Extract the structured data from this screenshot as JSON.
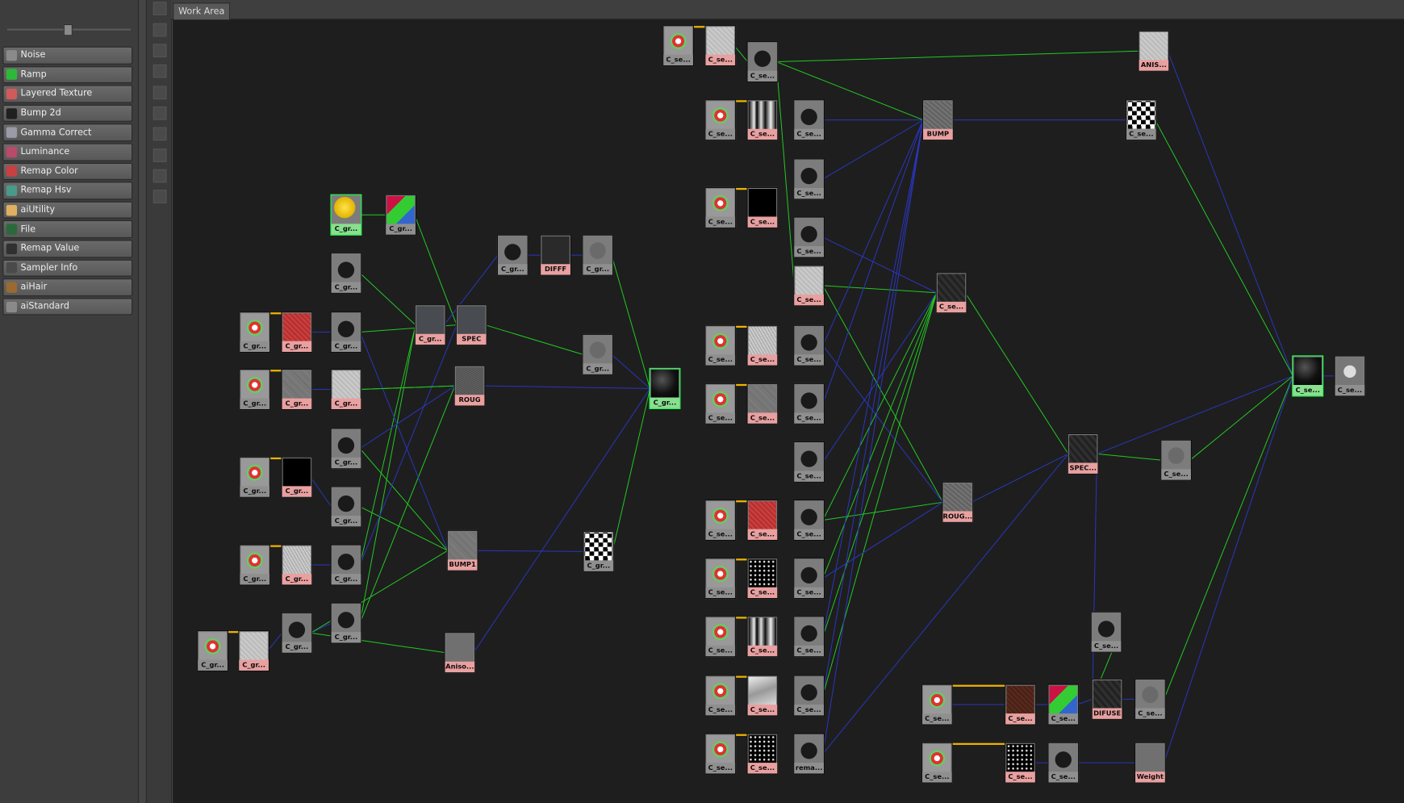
{
  "tab": {
    "label": "Work Area"
  },
  "library": {
    "items": [
      {
        "label": "Noise",
        "icon": "noise-icon",
        "color": "#8a8a8a"
      },
      {
        "label": "Ramp",
        "icon": "ramp-icon",
        "color": "#2eb83a"
      },
      {
        "label": "Layered Texture",
        "icon": "layered-texture-icon",
        "color": "#d05a5a"
      },
      {
        "label": "Bump 2d",
        "icon": "bump2d-icon",
        "color": "#202020"
      },
      {
        "label": "Gamma Correct",
        "icon": "gamma-correct-icon",
        "color": "#9a9aa8"
      },
      {
        "label": "Luminance",
        "icon": "luminance-icon",
        "color": "#b84a6a"
      },
      {
        "label": "Remap Color",
        "icon": "remap-color-icon",
        "color": "#c84040"
      },
      {
        "label": "Remap Hsv",
        "icon": "remap-hsv-icon",
        "color": "#4a9a8a"
      },
      {
        "label": "aiUtility",
        "icon": "aiutility-icon",
        "color": "#e0b060"
      },
      {
        "label": "File",
        "icon": "file-icon",
        "color": "#2a6a3a"
      },
      {
        "label": "Remap Value",
        "icon": "remap-value-icon",
        "color": "#303030"
      },
      {
        "label": "Sampler Info",
        "icon": "sampler-info-icon",
        "color": "#4a4a4a"
      },
      {
        "label": "aiHair",
        "icon": "aihair-icon",
        "color": "#9a6a30"
      },
      {
        "label": "aiStandard",
        "icon": "aistandard-icon",
        "color": "#8a8a8a"
      }
    ]
  },
  "nodes": [
    {
      "id": "n1",
      "label": "C_gr...",
      "kind": "sphere",
      "tint": "gn"
    },
    {
      "id": "n2",
      "label": "C_gr...",
      "kind": "rgb",
      "tint": ""
    },
    {
      "id": "n3",
      "label": "C_gr...",
      "kind": "tri",
      "tint": ""
    },
    {
      "id": "n4",
      "label": "C_gr...",
      "kind": "place",
      "tint": ""
    },
    {
      "id": "n5",
      "label": "C_gr...",
      "kind": "red",
      "tint": "pk"
    },
    {
      "id": "n6",
      "label": "C_gr...",
      "kind": "tri",
      "tint": ""
    },
    {
      "id": "n7",
      "label": "C_gr...",
      "kind": "place",
      "tint": ""
    },
    {
      "id": "n8",
      "label": "C_gr...",
      "kind": "noise",
      "tint": "pk"
    },
    {
      "id": "n9",
      "label": "C_gr...",
      "kind": "light",
      "tint": "pk"
    },
    {
      "id": "n10",
      "label": "C_gr...",
      "kind": "tri",
      "tint": ""
    },
    {
      "id": "n11",
      "label": "C_gr...",
      "kind": "place",
      "tint": ""
    },
    {
      "id": "n12",
      "label": "C_gr...",
      "kind": "black",
      "tint": "pk"
    },
    {
      "id": "n13",
      "label": "C_gr...",
      "kind": "tri",
      "tint": ""
    },
    {
      "id": "n14",
      "label": "C_gr...",
      "kind": "place",
      "tint": ""
    },
    {
      "id": "n15",
      "label": "C_gr...",
      "kind": "noisew",
      "tint": "pk"
    },
    {
      "id": "n16",
      "label": "C_gr...",
      "kind": "tri",
      "tint": ""
    },
    {
      "id": "n17",
      "label": "C_gr...",
      "kind": "place",
      "tint": ""
    },
    {
      "id": "n18",
      "label": "C_gr...",
      "kind": "light",
      "tint": "pk"
    },
    {
      "id": "n19",
      "label": "C_gr...",
      "kind": "tri",
      "tint": ""
    },
    {
      "id": "n20",
      "label": "C_gr...",
      "kind": "tri",
      "tint": ""
    },
    {
      "id": "n21",
      "label": "C_gr...",
      "kind": "dgrey",
      "tint": "pk"
    },
    {
      "id": "n22",
      "label": "SPEC",
      "kind": "dgrey",
      "tint": "pk"
    },
    {
      "id": "n23",
      "label": "ROUG",
      "kind": "noised",
      "tint": "pk"
    },
    {
      "id": "n24",
      "label": "BUMP1",
      "kind": "noise",
      "tint": "pk"
    },
    {
      "id": "n25",
      "label": "Aniso...",
      "kind": "mgrey",
      "tint": "pk"
    },
    {
      "id": "n26",
      "label": "C_gr...",
      "kind": "tri",
      "tint": ""
    },
    {
      "id": "n27",
      "label": "DIFFF",
      "kind": "dark",
      "tint": "pk"
    },
    {
      "id": "n28",
      "label": "C_gr...",
      "kind": "leaf",
      "tint": ""
    },
    {
      "id": "n29",
      "label": "C_gr...",
      "kind": "leaf",
      "tint": ""
    },
    {
      "id": "n30",
      "label": "C_gr...",
      "kind": "shader",
      "tint": "gn"
    },
    {
      "id": "n31",
      "label": "C_gr...",
      "kind": "checker",
      "tint": ""
    },
    {
      "id": "m1",
      "label": "C_se...",
      "kind": "place",
      "tint": ""
    },
    {
      "id": "m2",
      "label": "C_se...",
      "kind": "light",
      "tint": "pk"
    },
    {
      "id": "m3",
      "label": "C_se...",
      "kind": "tri",
      "tint": ""
    },
    {
      "id": "m4",
      "label": "C_se...",
      "kind": "place",
      "tint": ""
    },
    {
      "id": "m5",
      "label": "C_se...",
      "kind": "bwmap",
      "tint": "pk"
    },
    {
      "id": "m6",
      "label": "C_se...",
      "kind": "tri",
      "tint": ""
    },
    {
      "id": "m7",
      "label": "C_se...",
      "kind": "place",
      "tint": ""
    },
    {
      "id": "m8",
      "label": "C_se...",
      "kind": "black",
      "tint": "pk"
    },
    {
      "id": "m9",
      "label": "C_se...",
      "kind": "tri",
      "tint": ""
    },
    {
      "id": "m10",
      "label": "C_se...",
      "kind": "tri",
      "tint": ""
    },
    {
      "id": "m11",
      "label": "C_se...",
      "kind": "light",
      "tint": "pk"
    },
    {
      "id": "m12",
      "label": "C_se...",
      "kind": "place",
      "tint": ""
    },
    {
      "id": "m13",
      "label": "C_se...",
      "kind": "noisew",
      "tint": "pk"
    },
    {
      "id": "m14",
      "label": "C_se...",
      "kind": "tri",
      "tint": ""
    },
    {
      "id": "m15",
      "label": "C_se...",
      "kind": "place",
      "tint": ""
    },
    {
      "id": "m16",
      "label": "C_se...",
      "kind": "noise",
      "tint": "pk"
    },
    {
      "id": "m17",
      "label": "C_se...",
      "kind": "tri",
      "tint": ""
    },
    {
      "id": "m18",
      "label": "C_se...",
      "kind": "tri",
      "tint": ""
    },
    {
      "id": "m19",
      "label": "C_se...",
      "kind": "place",
      "tint": ""
    },
    {
      "id": "m20",
      "label": "C_se...",
      "kind": "red",
      "tint": "pk"
    },
    {
      "id": "m21",
      "label": "C_se...",
      "kind": "tri",
      "tint": ""
    },
    {
      "id": "m22",
      "label": "C_se...",
      "kind": "place",
      "tint": ""
    },
    {
      "id": "m23",
      "label": "C_se...",
      "kind": "speck",
      "tint": "pk"
    },
    {
      "id": "m24",
      "label": "C_se...",
      "kind": "tri",
      "tint": ""
    },
    {
      "id": "m25",
      "label": "C_se...",
      "kind": "place",
      "tint": ""
    },
    {
      "id": "m26",
      "label": "C_se...",
      "kind": "bwmap",
      "tint": "pk"
    },
    {
      "id": "m27",
      "label": "C_se...",
      "kind": "tri",
      "tint": ""
    },
    {
      "id": "m28",
      "label": "C_se...",
      "kind": "place",
      "tint": ""
    },
    {
      "id": "m29",
      "label": "C_se...",
      "kind": "lightmap",
      "tint": "pk"
    },
    {
      "id": "m30",
      "label": "C_se...",
      "kind": "tri",
      "tint": ""
    },
    {
      "id": "m31",
      "label": "C_se...",
      "kind": "place",
      "tint": ""
    },
    {
      "id": "m32",
      "label": "C_se...",
      "kind": "speck",
      "tint": "pk"
    },
    {
      "id": "m33",
      "label": "rema...",
      "kind": "tri",
      "tint": ""
    },
    {
      "id": "m34",
      "label": "BUMP",
      "kind": "concrete",
      "tint": "pk"
    },
    {
      "id": "m35",
      "label": "C_se...",
      "kind": "darkmap",
      "tint": "pk"
    },
    {
      "id": "m36",
      "label": "ROUG...",
      "kind": "concrete",
      "tint": "pk"
    },
    {
      "id": "m37",
      "label": "SPEC...",
      "kind": "darkmap",
      "tint": "pk"
    },
    {
      "id": "m38",
      "label": "ANIS...",
      "kind": "light",
      "tint": "pk"
    },
    {
      "id": "m39",
      "label": "C_se...",
      "kind": "checker",
      "tint": ""
    },
    {
      "id": "m40",
      "label": "C_se...",
      "kind": "leaf",
      "tint": ""
    },
    {
      "id": "m41",
      "label": "C_se...",
      "kind": "tri",
      "tint": ""
    },
    {
      "id": "m42",
      "label": "C_se...",
      "kind": "place",
      "tint": ""
    },
    {
      "id": "m43",
      "label": "C_se...",
      "kind": "brown",
      "tint": "pk"
    },
    {
      "id": "m44",
      "label": "C_se...",
      "kind": "rgb",
      "tint": ""
    },
    {
      "id": "m45",
      "label": "DIFUSE",
      "kind": "darkmap",
      "tint": "pk"
    },
    {
      "id": "m46",
      "label": "C_se...",
      "kind": "leaf",
      "tint": ""
    },
    {
      "id": "m47",
      "label": "C_se...",
      "kind": "place",
      "tint": ""
    },
    {
      "id": "m48",
      "label": "C_se...",
      "kind": "speck",
      "tint": "pk"
    },
    {
      "id": "m49",
      "label": "C_se...",
      "kind": "tri",
      "tint": ""
    },
    {
      "id": "m50",
      "label": "Weight",
      "kind": "mgrey",
      "tint": "pk"
    },
    {
      "id": "m51",
      "label": "C_se...",
      "kind": "shader",
      "tint": "gn"
    },
    {
      "id": "m52",
      "label": "C_se...",
      "kind": "sg",
      "tint": ""
    }
  ]
}
